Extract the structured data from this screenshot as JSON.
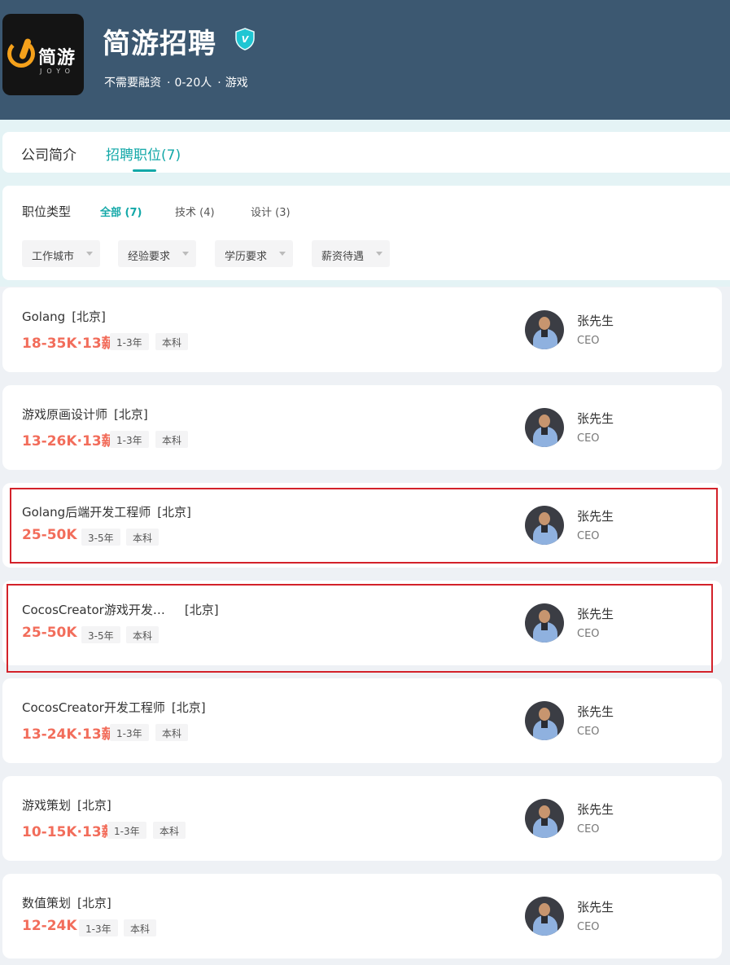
{
  "company": {
    "logo_text": "简游",
    "logo_sub": "JOYO",
    "name": "简游招聘",
    "verified_badge": "V",
    "meta": [
      "不需要融资",
      "0-20人",
      "游戏"
    ],
    "meta_separator": "·"
  },
  "tabs": [
    {
      "label": "公司简介",
      "active": false
    },
    {
      "label": "招聘职位(7)",
      "active": true
    }
  ],
  "filters": {
    "label": "职位类型",
    "categories": [
      {
        "label": "全部 (7)",
        "active": true
      },
      {
        "label": "技术 (4)",
        "active": false
      },
      {
        "label": "设计 (3)",
        "active": false
      }
    ],
    "dropdowns": [
      "工作城市",
      "经验要求",
      "学历要求",
      "薪资待遇"
    ]
  },
  "jobs": [
    {
      "title": "Golang",
      "city": "[北京]",
      "salary": "18-35K·13薪",
      "tags": [
        "1-3年",
        "本科"
      ],
      "recruiter": "张先生",
      "recruiter_title": "CEO",
      "highlighted": false
    },
    {
      "title": "游戏原画设计师",
      "city": "[北京]",
      "salary": "13-26K·13薪",
      "tags": [
        "1-3年",
        "本科"
      ],
      "recruiter": "张先生",
      "recruiter_title": "CEO",
      "highlighted": false
    },
    {
      "title": "Golang后端开发工程师",
      "city": "[北京]",
      "salary": "25-50K",
      "tags": [
        "3-5年",
        "本科"
      ],
      "recruiter": "张先生",
      "recruiter_title": "CEO",
      "highlighted": true
    },
    {
      "title": "CocosCreator游戏开发…",
      "city": "[北京]",
      "salary": "25-50K",
      "tags": [
        "3-5年",
        "本科"
      ],
      "recruiter": "张先生",
      "recruiter_title": "CEO",
      "highlighted": true
    },
    {
      "title": "CocosCreator开发工程师",
      "city": "[北京]",
      "salary": "13-24K·13薪",
      "tags": [
        "1-3年",
        "本科"
      ],
      "recruiter": "张先生",
      "recruiter_title": "CEO",
      "highlighted": false
    },
    {
      "title": "游戏策划",
      "city": "[北京]",
      "salary": "10-15K·13薪",
      "tags": [
        "1-3年",
        "本科"
      ],
      "recruiter": "张先生",
      "recruiter_title": "CEO",
      "highlighted": false
    },
    {
      "title": "数值策划",
      "city": "[北京]",
      "salary": "12-24K",
      "tags": [
        "1-3年",
        "本科"
      ],
      "recruiter": "张先生",
      "recruiter_title": "CEO",
      "highlighted": false
    }
  ],
  "colors": {
    "header": "#3c5871",
    "accent": "#13a8a8",
    "salary": "#f26d5b",
    "highlight": "#d3222a"
  }
}
